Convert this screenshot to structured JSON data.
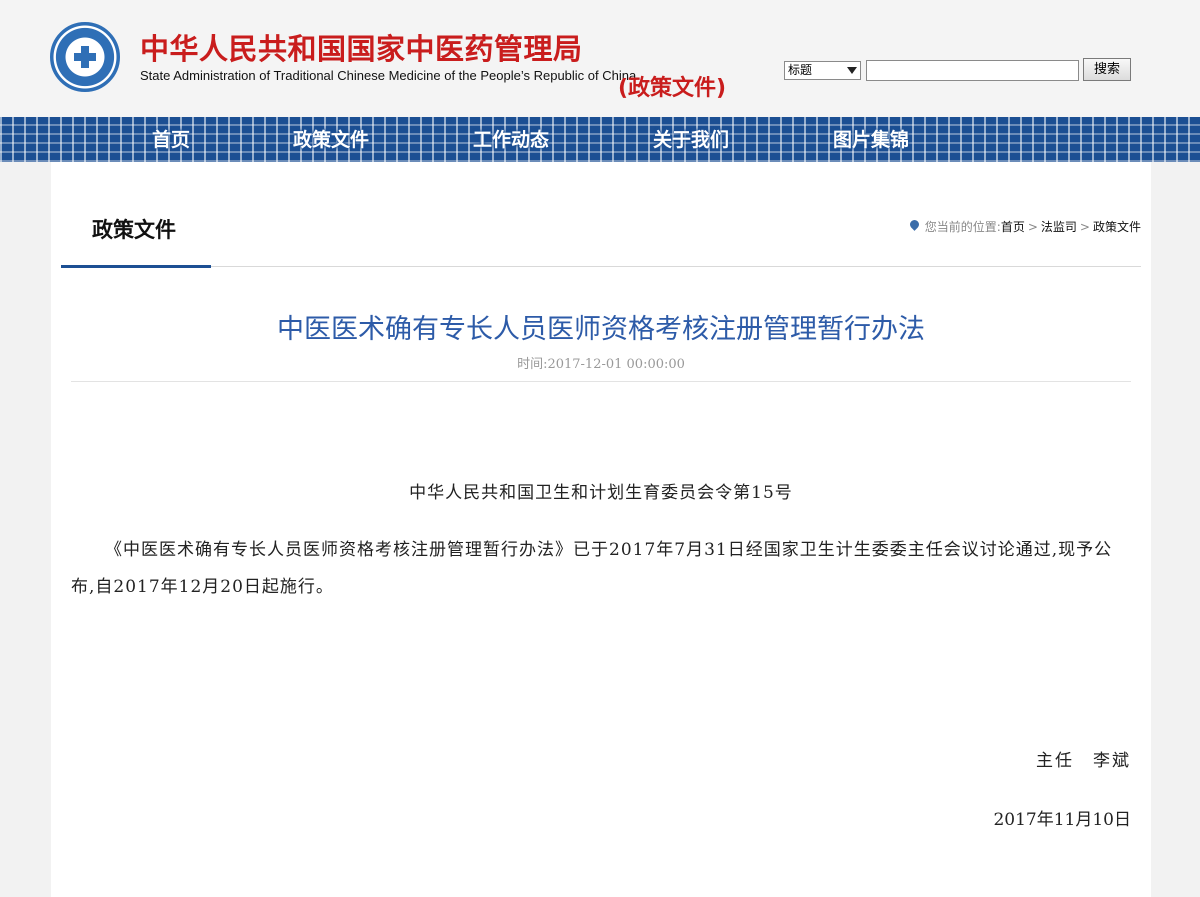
{
  "header": {
    "site_title_cn": "中华人民共和国国家中医药管理局",
    "site_title_en": "State Administration of Traditional Chinese Medicine of the People’s Republic of China",
    "section_tag": "(政策文件)",
    "logo_icon": "emblem-icon"
  },
  "search": {
    "select_value": "标题",
    "input_value": "",
    "button_label": "搜索"
  },
  "nav": {
    "items": [
      {
        "label": "首页"
      },
      {
        "label": "政策文件"
      },
      {
        "label": "工作动态"
      },
      {
        "label": "关于我们"
      },
      {
        "label": "图片集锦"
      }
    ]
  },
  "section": {
    "title": "政策文件",
    "breadcrumb_prefix": "您当前的位置:",
    "breadcrumb": [
      "首页",
      "法监司",
      "政策文件"
    ],
    "breadcrumb_sep": ">"
  },
  "article": {
    "title": "中医医术确有专长人员医师资格考核注册管理暂行办法",
    "time": "时间:2017-12-01 00:00:00",
    "order_line": "中华人民共和国卫生和计划生育委员会令第15号",
    "body": "《中医医术确有专长人员医师资格考核注册管理暂行办法》已于2017年7月31日经国家卫生计生委委主任会议讨论通过,现予公布,自2017年12月20日起施行。",
    "signature": "主任　李斌",
    "date": "2017年11月10日"
  },
  "colors": {
    "brand_red": "#c91d1d",
    "nav_blue": "#1c4f93",
    "title_blue": "#2d5ba8"
  }
}
